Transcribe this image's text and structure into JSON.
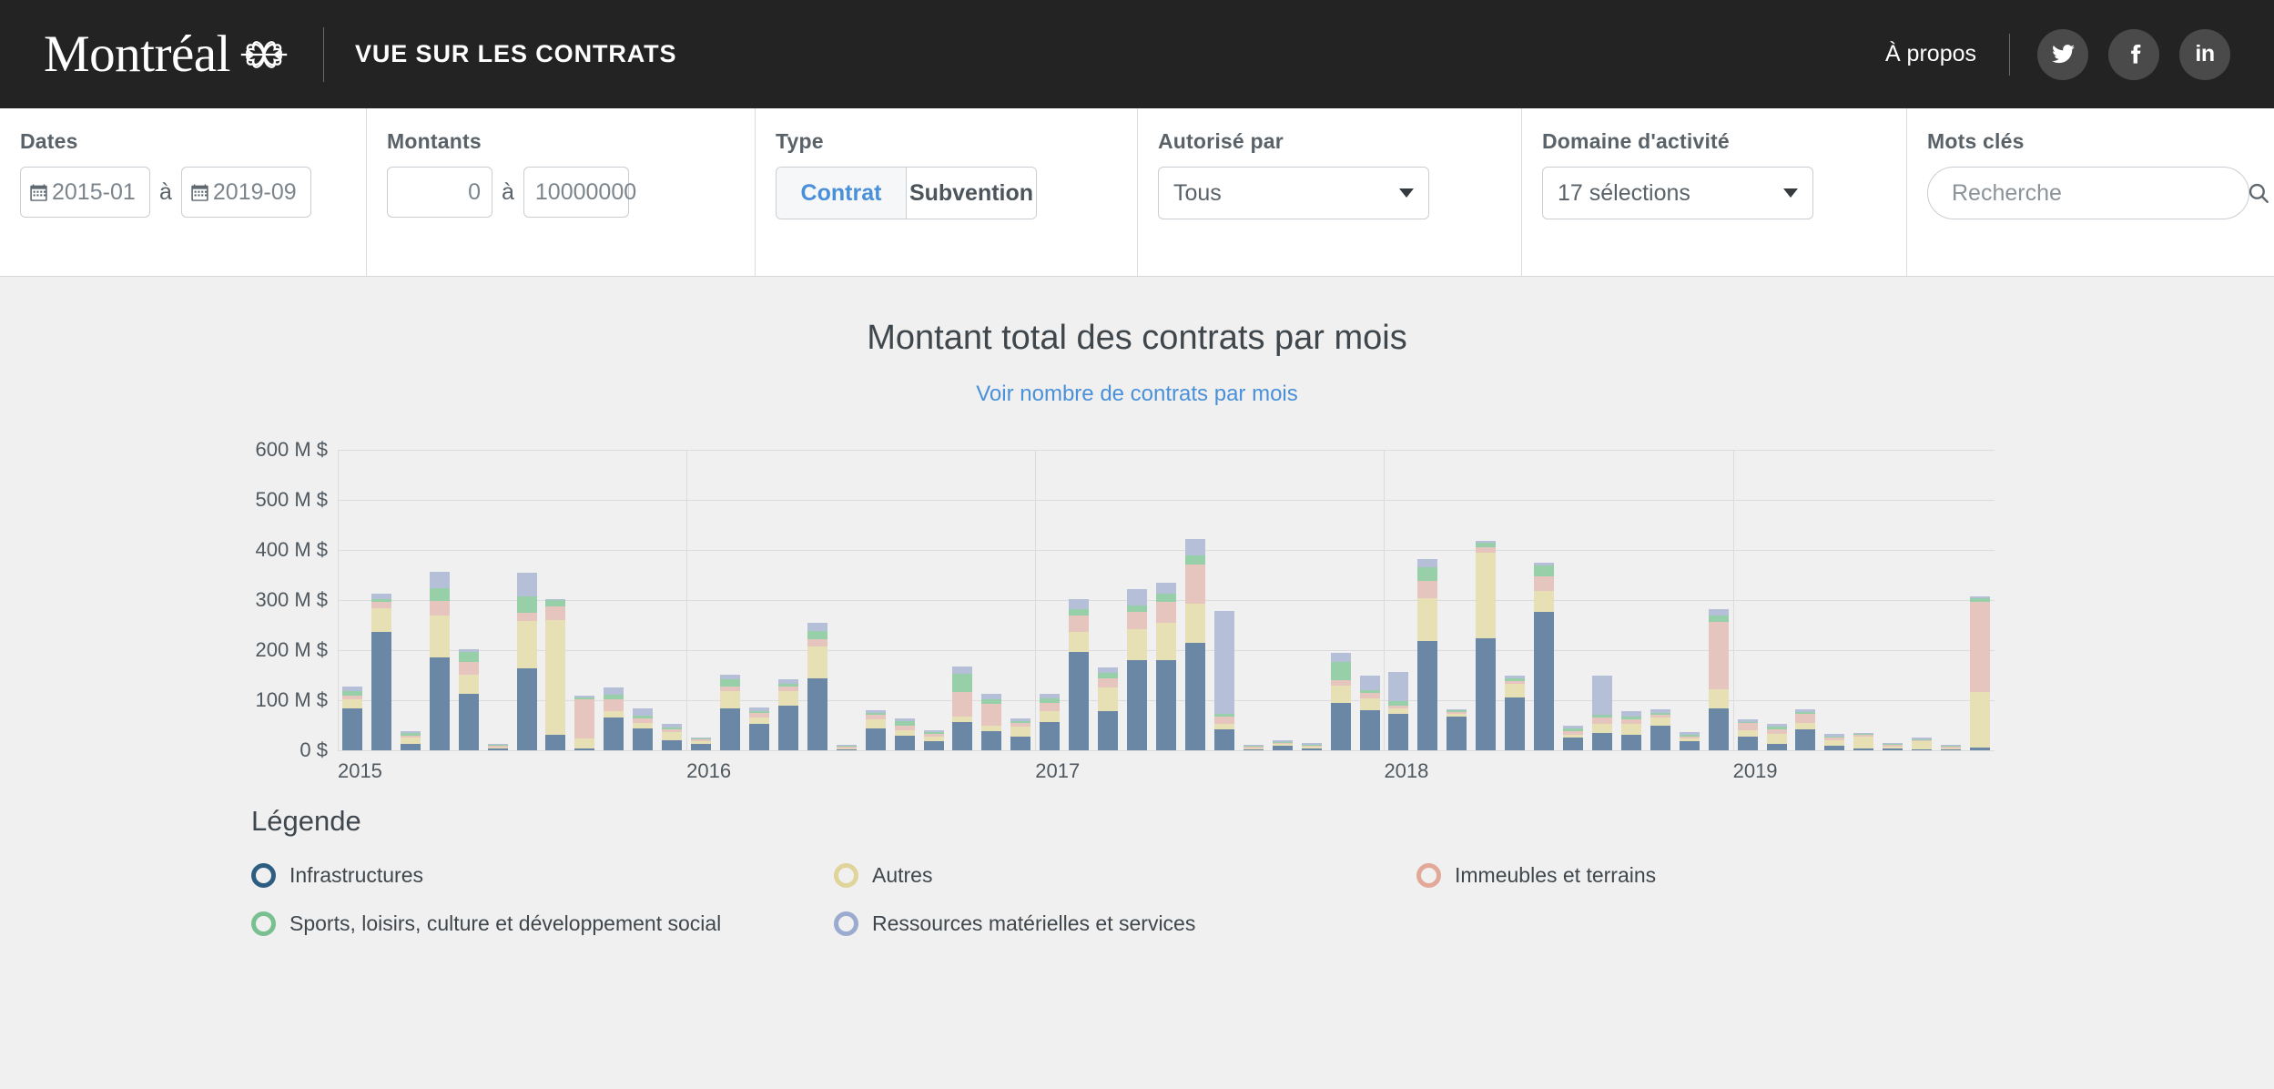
{
  "header": {
    "brand": "Montréal",
    "logo_icon": "montreal-flower-logo",
    "app_title": "VUE SUR LES CONTRATS",
    "about_label": "À propos",
    "social": [
      {
        "name": "twitter-icon",
        "label": "Twitter"
      },
      {
        "name": "facebook-icon",
        "label": "Facebook"
      },
      {
        "name": "linkedin-icon",
        "label": "in"
      }
    ]
  },
  "filters": {
    "dates": {
      "label": "Dates",
      "from_value": "2015-01",
      "to_value": "2019-09",
      "separator": "à",
      "icon": "calendar-icon"
    },
    "montants": {
      "label": "Montants",
      "from_value": "0",
      "to_value": "10000000",
      "separator": "à"
    },
    "type": {
      "label": "Type",
      "options": [
        "Contrat",
        "Subvention"
      ],
      "selected": "Contrat"
    },
    "autorise_par": {
      "label": "Autorisé par",
      "selected": "Tous",
      "caret": "chevron-down-icon"
    },
    "domaine": {
      "label": "Domaine d'activité",
      "selected": "17 sélections",
      "caret": "chevron-down-icon"
    },
    "mots_cles": {
      "label": "Mots clés",
      "placeholder": "Recherche",
      "value": "",
      "icon": "search-icon"
    }
  },
  "chart_header": {
    "title": "Montant total des contrats par mois",
    "toggle_link": "Voir nombre de contrats par mois"
  },
  "legend": {
    "title": "Légende",
    "items": [
      {
        "label": "Infrastructures",
        "color": "#2d5e82"
      },
      {
        "label": "Autres",
        "color": "#dfd49a"
      },
      {
        "label": "Immeubles et terrains",
        "color": "#e2a898"
      },
      {
        "label": "Sports, loisirs, culture et développement social",
        "color": "#79c090"
      },
      {
        "label": "Ressources matérielles et services",
        "color": "#9aabcf"
      }
    ]
  },
  "chart_data": {
    "type": "bar",
    "stacked": true,
    "title": "Montant total des contrats par mois",
    "subtitle": "Voir nombre de contrats par mois",
    "xlabel": "",
    "ylabel": "",
    "grid": true,
    "legend_position": "below",
    "ylim": [
      0,
      600
    ],
    "unit": "M $",
    "yticks": [
      0,
      100,
      200,
      300,
      400,
      500,
      600
    ],
    "ytick_labels": [
      "0 $",
      "100 M $",
      "200 M $",
      "300 M $",
      "400 M $",
      "500 M $",
      "600 M $"
    ],
    "xtick_labels": [
      "2015",
      "2016",
      "2017",
      "2018",
      "2019"
    ],
    "xtick_months": [
      "2015-01",
      "2016-01",
      "2017-01",
      "2018-01",
      "2019-01"
    ],
    "series_colors": {
      "Infrastructures": "#6a88a5",
      "Autres": "#e8e0b5",
      "Immeubles et terrains": "#e5c5bd",
      "Sports, loisirs, culture et développement social": "#97cfa9",
      "Ressources matérielles et services": "#b5c0d8"
    },
    "series_order": [
      "Infrastructures",
      "Autres",
      "Immeubles et terrains",
      "Sports, loisirs, culture et développement social",
      "Ressources matérielles et services"
    ],
    "categories": [
      "2015-01",
      "2015-02",
      "2015-03",
      "2015-04",
      "2015-05",
      "2015-06",
      "2015-07",
      "2015-08",
      "2015-09",
      "2015-10",
      "2015-11",
      "2015-12",
      "2016-01",
      "2016-02",
      "2016-03",
      "2016-04",
      "2016-05",
      "2016-06",
      "2016-07",
      "2016-08",
      "2016-09",
      "2016-10",
      "2016-11",
      "2016-12",
      "2017-01",
      "2017-02",
      "2017-03",
      "2017-04",
      "2017-05",
      "2017-06",
      "2017-07",
      "2017-08",
      "2017-09",
      "2017-10",
      "2017-11",
      "2017-12",
      "2018-01",
      "2018-02",
      "2018-03",
      "2018-04",
      "2018-05",
      "2018-06",
      "2018-07",
      "2018-08",
      "2018-09",
      "2018-10",
      "2018-11",
      "2018-12",
      "2019-01",
      "2019-02",
      "2019-03",
      "2019-04",
      "2019-05",
      "2019-06",
      "2019-07",
      "2019-08",
      "2019-09"
    ],
    "series": [
      {
        "name": "Infrastructures",
        "values": [
          84,
          236,
          12,
          186,
          113,
          4,
          163,
          31,
          4,
          66,
          44,
          20,
          12,
          83,
          52,
          90,
          143,
          2,
          44,
          30,
          18,
          56,
          38,
          27,
          57,
          197,
          78,
          180,
          180,
          215,
          42,
          2,
          9,
          4,
          95,
          80,
          72,
          218,
          68,
          224,
          105,
          277,
          25,
          34,
          31,
          50,
          18,
          83,
          28,
          12,
          41,
          10,
          4,
          3,
          2,
          2,
          6
        ]
      },
      {
        "name": "Autres",
        "values": [
          18,
          48,
          14,
          84,
          38,
          2,
          96,
          229,
          20,
          12,
          10,
          16,
          6,
          36,
          14,
          28,
          64,
          1,
          18,
          10,
          9,
          12,
          12,
          20,
          22,
          40,
          48,
          62,
          74,
          78,
          10,
          1,
          3,
          3,
          35,
          24,
          12,
          86,
          4,
          170,
          28,
          42,
          6,
          18,
          22,
          16,
          6,
          38,
          12,
          20,
          14,
          10,
          24,
          5,
          16,
          2,
          110
        ]
      },
      {
        "name": "Immeubles et terrains",
        "values": [
          8,
          12,
          3,
          29,
          26,
          1,
          16,
          28,
          78,
          24,
          9,
          6,
          3,
          9,
          8,
          9,
          14,
          1,
          9,
          10,
          5,
          48,
          42,
          7,
          16,
          32,
          18,
          34,
          42,
          78,
          15,
          1,
          2,
          2,
          10,
          10,
          6,
          35,
          5,
          12,
          6,
          28,
          8,
          13,
          9,
          5,
          4,
          136,
          14,
          10,
          17,
          5,
          3,
          2,
          2,
          1,
          180
        ]
      },
      {
        "name": "Sports, loisirs, culture et développement social",
        "values": [
          8,
          6,
          5,
          24,
          19,
          2,
          32,
          12,
          4,
          9,
          6,
          4,
          2,
          13,
          4,
          5,
          18,
          1,
          3,
          8,
          4,
          37,
          10,
          4,
          8,
          12,
          10,
          14,
          16,
          18,
          6,
          1,
          2,
          2,
          36,
          6,
          8,
          26,
          3,
          8,
          4,
          22,
          4,
          6,
          5,
          4,
          3,
          13,
          3,
          5,
          4,
          3,
          2,
          1,
          1,
          1,
          8
        ]
      },
      {
        "name": "Ressources matérielles et services",
        "values": [
          10,
          10,
          4,
          33,
          6,
          2,
          47,
          2,
          3,
          14,
          14,
          6,
          3,
          10,
          7,
          9,
          16,
          1,
          7,
          6,
          4,
          14,
          10,
          5,
          10,
          20,
          12,
          32,
          22,
          32,
          205,
          2,
          3,
          4,
          18,
          30,
          58,
          16,
          2,
          4,
          6,
          6,
          6,
          78,
          12,
          6,
          5,
          12,
          5,
          5,
          5,
          4,
          2,
          2,
          1,
          1,
          4
        ]
      }
    ]
  }
}
